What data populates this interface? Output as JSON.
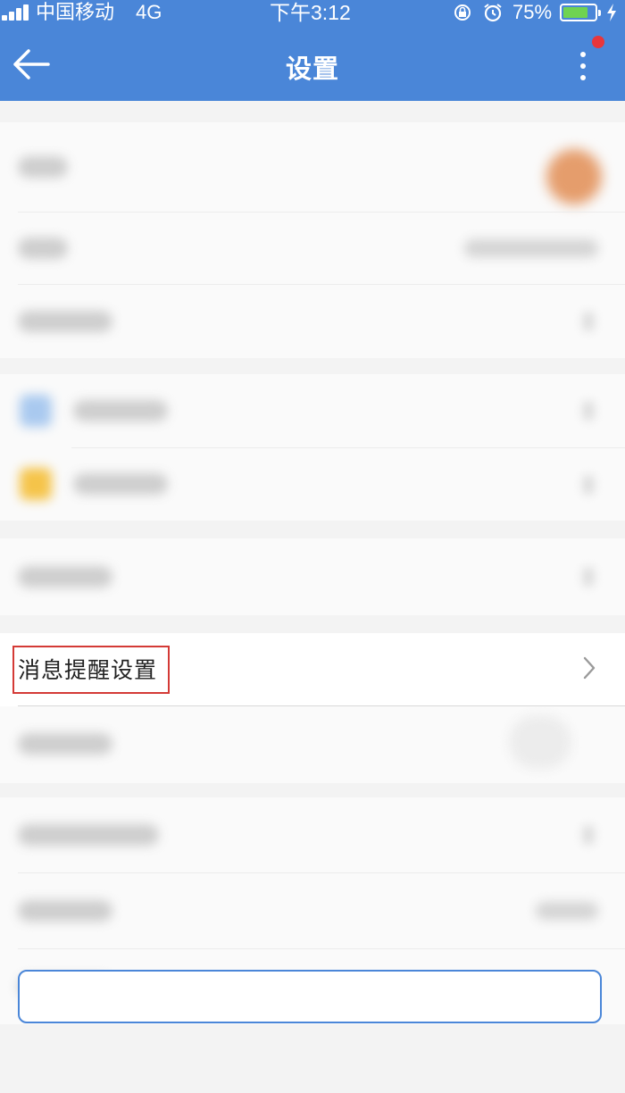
{
  "status_bar": {
    "carrier": "中国移动",
    "network": "4G",
    "time": "下午3:12",
    "battery_percent": "75%",
    "battery_level": 0.75,
    "icons": [
      "signal-icon",
      "rotation-lock-icon",
      "alarm-icon",
      "battery-icon",
      "charging-icon"
    ]
  },
  "nav": {
    "title": "设置",
    "back_icon": "arrow-left-icon",
    "more_icon": "more-vertical-icon",
    "badge_color": "#e8363b"
  },
  "settings": {
    "highlighted_item": {
      "label": "消息提醒设置",
      "chevron_icon": "chevron-right-icon"
    }
  },
  "colors": {
    "header": "#4a86d8",
    "highlight_border": "#d43a36"
  }
}
